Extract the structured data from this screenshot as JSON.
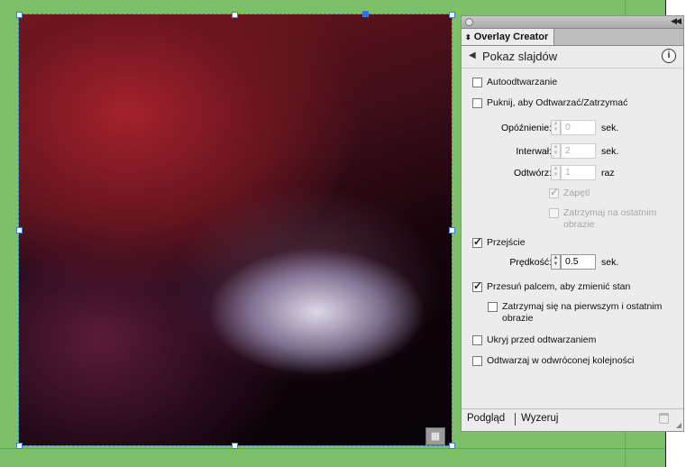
{
  "panel": {
    "tab_title": "Overlay Creator",
    "header_title": "Pokaz slajdów",
    "options": {
      "autoplay": {
        "label": "Autoodtwarzanie",
        "checked": false
      },
      "tap_play_pause": {
        "label": "Puknij, aby Odtwarzać/Zatrzymać",
        "checked": false
      },
      "delay": {
        "label": "Opóźnienie:",
        "value": "0",
        "unit": "sek."
      },
      "interval": {
        "label": "Interwał:",
        "value": "2",
        "unit": "sek."
      },
      "play_count": {
        "label": "Odtwórz:",
        "value": "1",
        "unit": "raz"
      },
      "loop": {
        "label": "Zapętl",
        "checked": true
      },
      "stop_last": {
        "label_line1": "Zatrzymaj na ostatnim",
        "label_line2": "obrazie",
        "checked": false
      },
      "transition": {
        "label": "Przejście",
        "checked": true
      },
      "speed": {
        "label": "Prędkość:",
        "value": "0.5",
        "unit": "sek."
      },
      "swipe": {
        "label": "Przesuń palcem, aby zmienić stan",
        "checked": true
      },
      "stop_first_last": {
        "label_line1": "Zatrzymaj się na pierwszym i ostatnim",
        "label_line2": "obrazie",
        "checked": false
      },
      "hide_before": {
        "label": "Ukryj przed odtwarzaniem",
        "checked": false
      },
      "reverse": {
        "label": "Odtwarzaj w odwróconej kolejności",
        "checked": false
      }
    },
    "footer": {
      "preview": "Podgląd",
      "reset": "Wyzeruj"
    }
  },
  "icons": {
    "collapse": "double-chevron-icon",
    "back": "triangle-left-icon",
    "info": "info-icon",
    "trash": "trash-icon",
    "frame": "image-frame-icon"
  },
  "colors": {
    "background": "#7cc06a",
    "selection": "#3f7be0",
    "panel": "#ececec"
  }
}
